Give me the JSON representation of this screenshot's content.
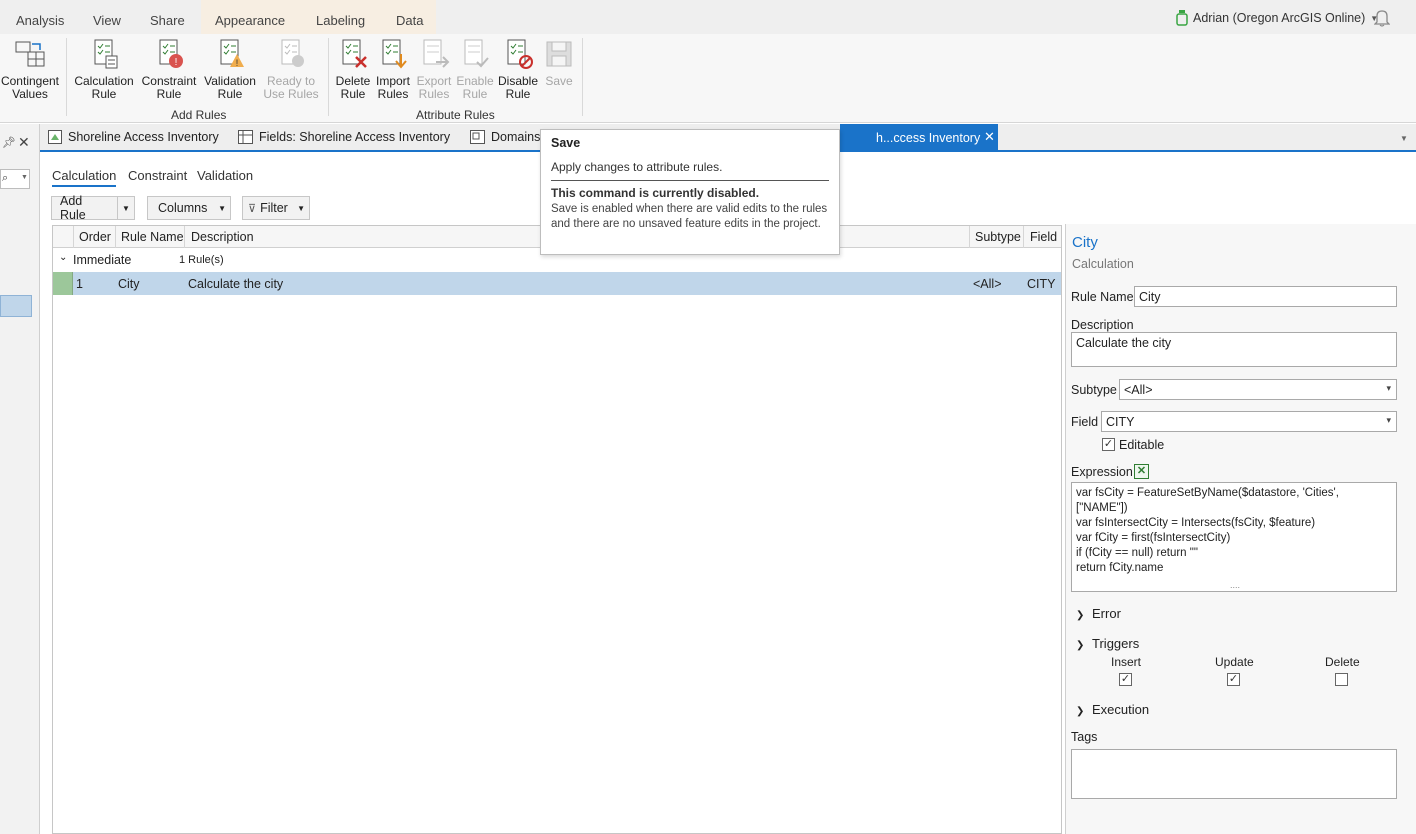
{
  "ribbon_tabs": [
    "Analysis",
    "View",
    "Share",
    "Appearance",
    "Labeling",
    "Data"
  ],
  "user": {
    "name": "Adrian (Oregon ArcGIS Online)"
  },
  "ribbon": {
    "contingent_values": "Contingent Values",
    "calculation_rule": "Calculation Rule",
    "constraint_rule": "Constraint Rule",
    "validation_rule": "Validation Rule",
    "ready_to_use": "Ready to Use Rules",
    "delete_rule": "Delete Rule",
    "import_rules": "Import Rules",
    "export_rules": "Export Rules",
    "enable_rule": "Enable Rule",
    "disable_rule": "Disable Rule",
    "save": "Save",
    "group_add_rules": "Add Rules",
    "group_attribute_rules": "Attribute Rules"
  },
  "doc_tabs": {
    "tab1": "Shoreline Access Inventory",
    "tab2": "Fields:  Shoreline Access Inventory",
    "tab3": "Domains:",
    "active": "h...ccess Inventory"
  },
  "subtabs": [
    "Calculation",
    "Constraint",
    "Validation"
  ],
  "toolbar": {
    "add_rule": "Add Rule",
    "columns": "Columns",
    "filter": "Filter"
  },
  "grid": {
    "headers": {
      "order": "Order",
      "rule_name": "Rule Name",
      "description": "Description",
      "subtype": "Subtype",
      "field": "Field"
    },
    "group": {
      "name": "Immediate",
      "count": "1 Rule(s)"
    },
    "row": {
      "order": "1",
      "rule_name": "City",
      "description": "Calculate the city",
      "subtype": "<All>",
      "field": "CITY"
    }
  },
  "details": {
    "title": "City",
    "type": "Calculation",
    "rule_name_label": "Rule Name",
    "rule_name_value": "City",
    "description_label": "Description",
    "description_value": "Calculate the city",
    "subtype_label": "Subtype",
    "subtype_value": "<All>",
    "field_label": "Field",
    "field_value": "CITY",
    "editable_label": "Editable",
    "expression_label": "Expression",
    "expression_lines": [
      "var fsCity = FeatureSetByName($datastore, 'Cities',",
      "[\"NAME\"])",
      "var fsIntersectCity = Intersects(fsCity, $feature)",
      "var fCity = first(fsIntersectCity)",
      "if (fCity == null) return \"\"",
      "return fCity.name"
    ],
    "error_label": "Error",
    "triggers_label": "Triggers",
    "insert_label": "Insert",
    "update_label": "Update",
    "delete_label": "Delete",
    "execution_label": "Execution",
    "tags_label": "Tags"
  },
  "tooltip": {
    "title": "Save",
    "desc": "Apply changes to attribute rules.",
    "disabled_title": "This command is currently disabled.",
    "disabled_desc": "Save is enabled when there are valid edits to the rules and there are no unsaved feature edits in the project."
  },
  "colors": {
    "accent": "#1a73c9",
    "selected_row": "#c0d6ea",
    "context_tab_band": "#f7eee2"
  }
}
